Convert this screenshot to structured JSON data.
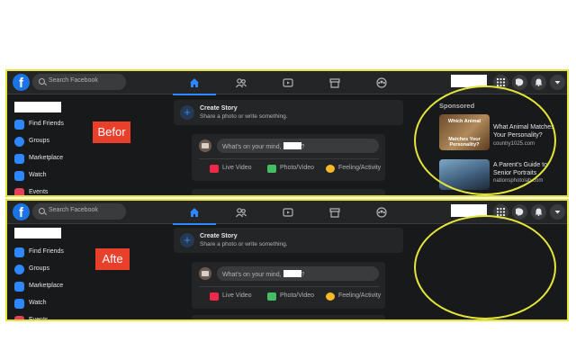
{
  "search": {
    "placeholder": "Search Facebook"
  },
  "sidebar": {
    "items": [
      {
        "label": "Find Friends",
        "icon": "friends-icon",
        "color": "#2d88ff"
      },
      {
        "label": "Groups",
        "icon": "groups-icon",
        "color": "#2d88ff"
      },
      {
        "label": "Marketplace",
        "icon": "marketplace-icon",
        "color": "#2d88ff"
      },
      {
        "label": "Watch",
        "icon": "watch-icon",
        "color": "#2d88ff"
      },
      {
        "label": "Events",
        "icon": "events-icon",
        "color": "#e4405f"
      }
    ]
  },
  "story": {
    "title": "Create Story",
    "subtitle": "Share a photo or write something."
  },
  "composer": {
    "prompt": "What's on your mind,",
    "prompt_suffix": "?",
    "actions": [
      {
        "label": "Live Video",
        "icon": "live-video-icon",
        "color": "#f02849"
      },
      {
        "label": "Photo/Video",
        "icon": "photo-video-icon",
        "color": "#45bd62"
      },
      {
        "label": "Feeling/Activity",
        "icon": "feeling-icon",
        "color": "#f7b928"
      }
    ]
  },
  "labels": {
    "before": "Befor",
    "after": "Afte"
  },
  "ads": {
    "heading": "Sponsored",
    "items": [
      {
        "title": "What Animal Matches Your Personality?",
        "domain": "country1025.com",
        "thumb_top": "Which Animal",
        "thumb_bottom": "Matches Your Personality?"
      },
      {
        "title": "A Parent's Guide to Senior Portraits",
        "domain": "nationsphotolab.com"
      }
    ]
  },
  "colors": {
    "accent": "#2d88ff",
    "highlight": "#e4e43a",
    "badge": "#e8402a",
    "brand": "#1b74e4"
  }
}
